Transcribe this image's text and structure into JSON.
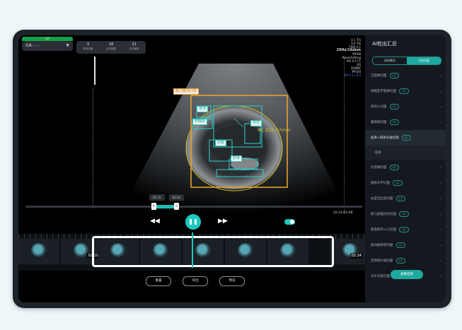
{
  "ga": {
    "badge": "GA",
    "value": "GA: - -"
  },
  "stats": [
    {
      "value": "3",
      "label": "有效切面"
    },
    {
      "value": "18",
      "label": "总切面数"
    },
    {
      "value": "21",
      "label": "总切面数"
    }
  ],
  "params": [
    "0.1 TIS",
    "0.0 TIb",
    "TIB0 0.1",
    "29Hz/16dsm",
    "MFSM",
    "PowerSetting",
    "M5 0.5 F1",
    "I/Q",
    "2DMBF",
    "PP100",
    "DR 0.1 / 0.5"
  ],
  "annotations": {
    "orange_label": "胎儿腹围切面",
    "teal_labels": [
      "胃泡",
      "脐静脉",
      "脊柱",
      "肝脏",
      "肋骨"
    ],
    "measurement": "AC 205.47mm"
  },
  "timeline": {
    "tag_left": "02:15",
    "tag_right": "02:24",
    "handle_left": "6",
    "handle_right": "6",
    "time_display": "02:21/03:08"
  },
  "controls": {
    "rewind": "◀◀",
    "play": "❚❚",
    "forward": "▶▶"
  },
  "filmstrip": {
    "frame_label_left": "02:19",
    "frame_label_right": "02:24"
  },
  "action_buttons": [
    "重置",
    "导出",
    "预览"
  ],
  "panel": {
    "title": "AI检出汇总",
    "tabs": [
      "质控模式",
      "已检切面"
    ],
    "items": [
      {
        "label": "丘脑横切面",
        "badge": "1/1"
      },
      {
        "label": "侧脑室平面横切面",
        "badge": "1/1"
      },
      {
        "label": "四腔心切面",
        "badge": "1/1"
      },
      {
        "label": "腹围横切面",
        "badge": "1/1"
      },
      {
        "label": "股骨+腓骨长轴切面",
        "badge": "1/1"
      },
      {
        "label": "股骨",
        "badge": "",
        "sub": true
      },
      {
        "label": "双肾横切面",
        "badge": "1/1"
      },
      {
        "label": "膀胱水平切面",
        "badge": "1/1"
      },
      {
        "label": "右室流出道切面",
        "badge": "1/1"
      },
      {
        "label": "胎儿颜面冠状切面",
        "badge": "1/1"
      },
      {
        "label": "胎盘脐带入口切面",
        "badge": "1/1"
      },
      {
        "label": "脐动脉频谱切面",
        "badge": "1/1"
      },
      {
        "label": "宫颈管长轴切面",
        "badge": "1/1"
      },
      {
        "label": "羊水深度切面",
        "badge": "1/1"
      }
    ],
    "float_button": "查看结果"
  },
  "colors": {
    "accent": "#1dc9bd",
    "orange_box": "#e9a030",
    "ellipse": "#d9c320",
    "ga_green": "#16a14b"
  }
}
